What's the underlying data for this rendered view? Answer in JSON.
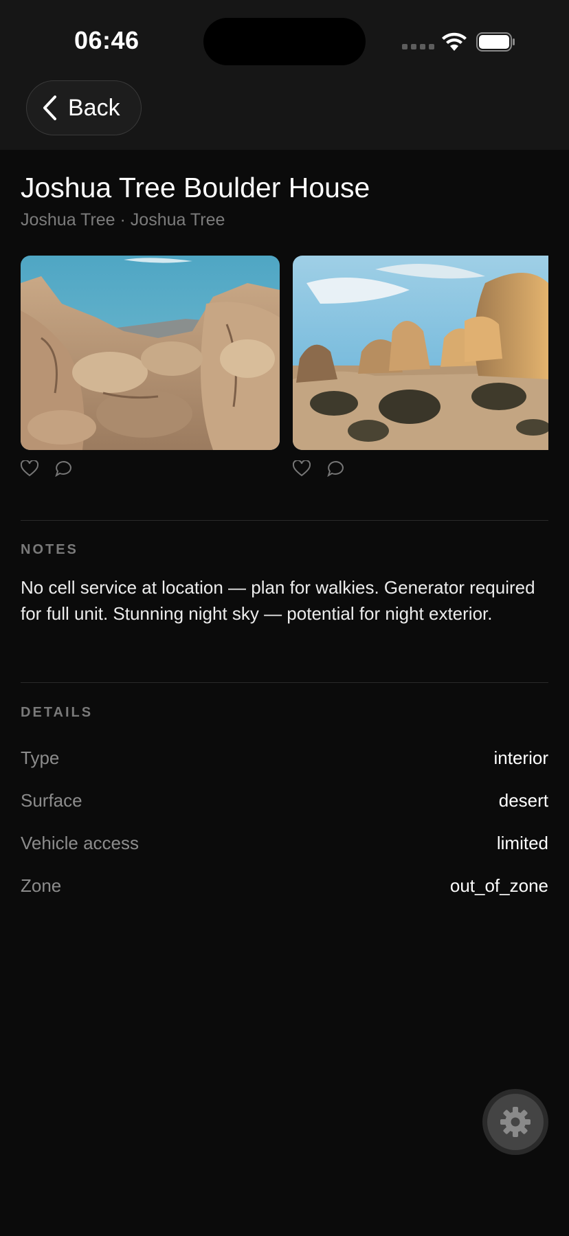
{
  "status_bar": {
    "time": "06:46"
  },
  "nav": {
    "back_label": "Back"
  },
  "location": {
    "title": "Joshua Tree Boulder House",
    "subtitle": "Joshua Tree · Joshua Tree"
  },
  "photos": [
    {
      "icon_like": "heart-icon",
      "icon_comment": "comment-icon"
    },
    {
      "icon_like": "heart-icon",
      "icon_comment": "comment-icon"
    }
  ],
  "notes": {
    "label": "NOTES",
    "text": "No cell service at location — plan for walkies. Generator required for full unit. Stunning night sky — potential for night exterior."
  },
  "details": {
    "label": "DETAILS",
    "rows": [
      {
        "key": "Type",
        "value": "interior"
      },
      {
        "key": "Surface",
        "value": "desert"
      },
      {
        "key": "Vehicle access",
        "value": "limited"
      },
      {
        "key": "Zone",
        "value": "out_of_zone"
      }
    ]
  },
  "fab": {
    "icon": "gear-icon"
  },
  "colors": {
    "background": "#0b0b0b",
    "header": "#161616",
    "muted_text": "#7c7c7c"
  }
}
